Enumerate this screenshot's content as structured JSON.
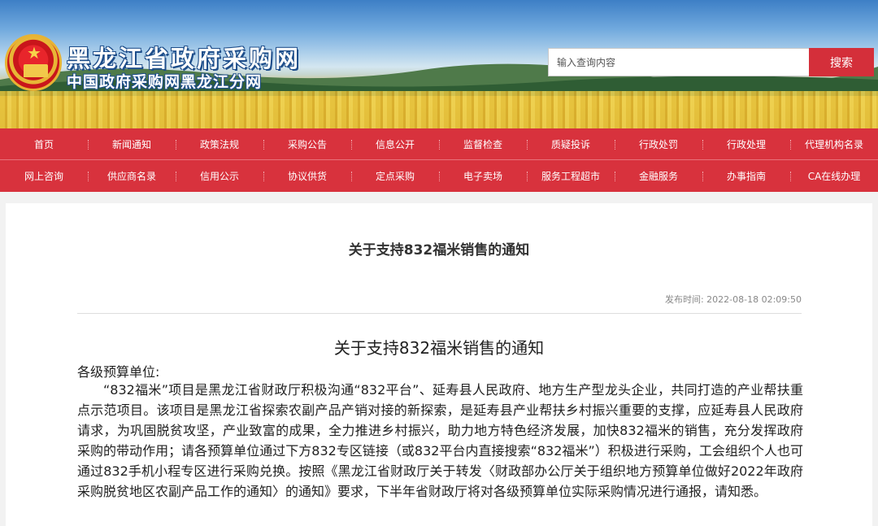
{
  "header": {
    "site_title": "黑龙江省政府采购网",
    "site_subtitle": "中国政府采购网黑龙江分网",
    "search_placeholder": "输入查询内容",
    "search_button": "搜索"
  },
  "nav": {
    "row1": [
      "首页",
      "新闻通知",
      "政策法规",
      "采购公告",
      "信息公开",
      "监督检查",
      "质疑投诉",
      "行政处罚",
      "行政处理",
      "代理机构名录"
    ],
    "row2": [
      "网上咨询",
      "供应商名录",
      "信用公示",
      "协议供货",
      "定点采购",
      "电子卖场",
      "服务工程超市",
      "金融服务",
      "办事指南",
      "CA在线办理"
    ]
  },
  "article": {
    "title": "关于支持832福米销售的通知",
    "publish_label": "发布时间:",
    "publish_time": "2022-08-18 02:09:50",
    "body_title": "关于支持832福米销售的通知",
    "salutation": "各级预算单位:",
    "paragraph": "“832福米”项目是黑龙江省财政厅积极沟通“832平台”、延寿县人民政府、地方生产型龙头企业，共同打造的产业帮扶重点示范项目。该项目是黑龙江省探索农副产品产销对接的新探索，是延寿县产业帮扶乡村振兴重要的支撑，应延寿县人民政府请求，为巩固脱贫攻坚，产业致富的成果，全力推进乡村振兴，助力地方特色经济发展，加快832福米的销售，充分发挥政府采购的带动作用；请各预算单位通过下方832专区链接（或832平台内直接搜索“832福米”）积极进行采购，工会组织个人也可通过832手机小程专区进行采购兑换。按照《黑龙江省财政厅关于转发〈财政部办公厅关于组织地方预算单位做好2022年政府采购脱贫地区农副产品工作的通知〉的通知》要求，下半年省财政厅将对各级预算单位实际采购情况进行通报，请知悉。"
  },
  "colors": {
    "nav_red": "#d8323d",
    "search_red": "#d42f3a"
  }
}
